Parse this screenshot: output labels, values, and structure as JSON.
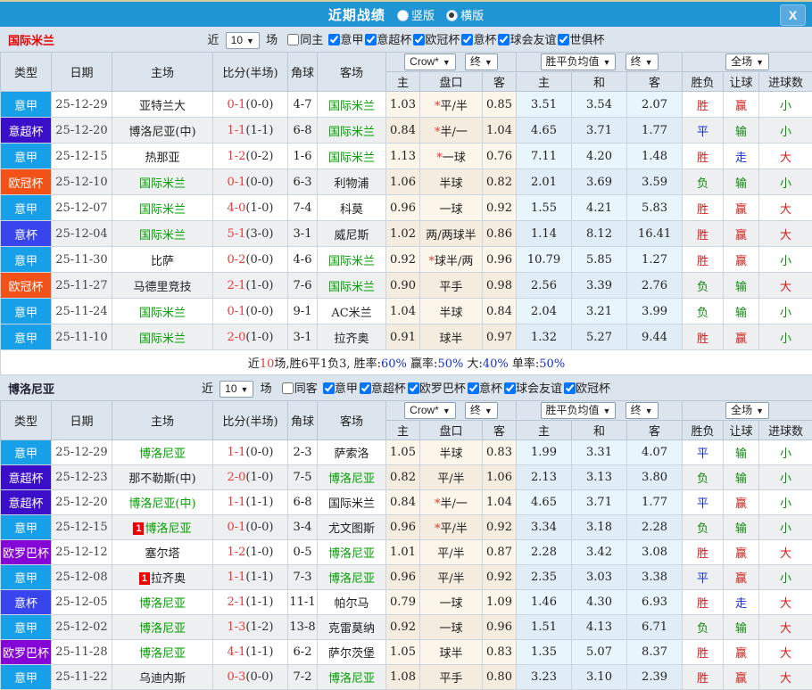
{
  "titlebar": {
    "title": "近期战绩",
    "radio_vertical": "竖版",
    "radio_horizontal": "横版",
    "close": "X"
  },
  "colors": {
    "titlebar_blue": "#1f95d4",
    "focal_team_green": "#00a000",
    "score_red": "#e43b3b",
    "win_red": "#d02020",
    "draw_blue": "#1530d0",
    "lose_green": "#128812"
  },
  "type_colors": {
    "意甲": "#17a0e8",
    "意超杯": "#3b0fc9",
    "欧冠杯": "#f25117",
    "意杯": "#3845ee",
    "欧罗巴杯": "#8406d6"
  },
  "table_headers": {
    "type": "类型",
    "date": "日期",
    "home": "主场",
    "score": "比分(半场)",
    "corner": "角球",
    "away": "客场",
    "crow": "Crow*",
    "final": "终",
    "odds_home": "主",
    "odds_line": "盘口",
    "odds_away": "客",
    "avg_label": "胜平负均值",
    "avg_home": "主",
    "avg_draw": "和",
    "avg_away": "客",
    "fullmatch": "全场",
    "wdl": "胜负",
    "handicap": "让球",
    "goals": "进球数"
  },
  "sections": [
    {
      "team": "国际米兰",
      "team_color": "#e60000",
      "filters": {
        "near": "近",
        "count": "10",
        "games": "场",
        "same": "同主",
        "same_checked": false,
        "leagues": [
          {
            "label": "意甲",
            "checked": true
          },
          {
            "label": "意超杯",
            "checked": true
          },
          {
            "label": "欧冠杯",
            "checked": true
          },
          {
            "label": "意杯",
            "checked": true
          },
          {
            "label": "球会友谊",
            "checked": true
          },
          {
            "label": "世俱杯",
            "checked": true
          }
        ]
      },
      "rows": [
        {
          "type": "意甲",
          "date": "25-12-29",
          "home": "亚特兰大",
          "hh": false,
          "score": "0-1",
          "half": "(0-0)",
          "corner": "4-7",
          "away": "国际米兰",
          "ah": true,
          "o1": "1.03",
          "star": true,
          "line": "平/半",
          "o2": "0.85",
          "a1": "3.51",
          "a2": "3.54",
          "a3": "2.07",
          "r1": "胜",
          "r2": "赢",
          "r3": "小"
        },
        {
          "type": "意超杯",
          "date": "25-12-20",
          "home": "博洛尼亚(中)",
          "hh": false,
          "score": "1-1",
          "half": "(1-1)",
          "corner": "6-8",
          "away": "国际米兰",
          "ah": true,
          "o1": "0.84",
          "star": true,
          "line": "半/一",
          "o2": "1.04",
          "a1": "4.65",
          "a2": "3.71",
          "a3": "1.77",
          "r1": "平",
          "r2": "输",
          "r3": "小"
        },
        {
          "type": "意甲",
          "date": "25-12-15",
          "home": "热那亚",
          "hh": false,
          "score": "1-2",
          "half": "(0-2)",
          "corner": "1-6",
          "away": "国际米兰",
          "ah": true,
          "o1": "1.13",
          "star": true,
          "line": "一球",
          "o2": "0.76",
          "a1": "7.11",
          "a2": "4.20",
          "a3": "1.48",
          "r1": "胜",
          "r2": "走",
          "r3": "大"
        },
        {
          "type": "欧冠杯",
          "date": "25-12-10",
          "home": "国际米兰",
          "hh": true,
          "score": "0-1",
          "half": "(0-0)",
          "corner": "6-3",
          "away": "利物浦",
          "ah": false,
          "o1": "1.06",
          "star": false,
          "line": "半球",
          "o2": "0.82",
          "a1": "2.01",
          "a2": "3.69",
          "a3": "3.59",
          "r1": "负",
          "r2": "输",
          "r3": "小"
        },
        {
          "type": "意甲",
          "date": "25-12-07",
          "home": "国际米兰",
          "hh": true,
          "score": "4-0",
          "half": "(1-0)",
          "corner": "7-4",
          "away": "科莫",
          "ah": false,
          "o1": "0.96",
          "star": false,
          "line": "一球",
          "o2": "0.92",
          "a1": "1.55",
          "a2": "4.21",
          "a3": "5.83",
          "r1": "胜",
          "r2": "赢",
          "r3": "大"
        },
        {
          "type": "意杯",
          "date": "25-12-04",
          "home": "国际米兰",
          "hh": true,
          "score": "5-1",
          "half": "(3-0)",
          "corner": "3-1",
          "away": "威尼斯",
          "ah": false,
          "o1": "1.02",
          "star": false,
          "line": "两/两球半",
          "o2": "0.86",
          "a1": "1.14",
          "a2": "8.12",
          "a3": "16.41",
          "r1": "胜",
          "r2": "赢",
          "r3": "大"
        },
        {
          "type": "意甲",
          "date": "25-11-30",
          "home": "比萨",
          "hh": false,
          "score": "0-2",
          "half": "(0-0)",
          "corner": "4-6",
          "away": "国际米兰",
          "ah": true,
          "o1": "0.92",
          "star": true,
          "line": "球半/两",
          "o2": "0.96",
          "a1": "10.79",
          "a2": "5.85",
          "a3": "1.27",
          "r1": "胜",
          "r2": "赢",
          "r3": "小"
        },
        {
          "type": "欧冠杯",
          "date": "25-11-27",
          "home": "马德里竞技",
          "hh": false,
          "score": "2-1",
          "half": "(1-0)",
          "corner": "7-6",
          "away": "国际米兰",
          "ah": true,
          "o1": "0.90",
          "star": false,
          "line": "平手",
          "o2": "0.98",
          "a1": "2.56",
          "a2": "3.39",
          "a3": "2.76",
          "r1": "负",
          "r2": "输",
          "r3": "大"
        },
        {
          "type": "意甲",
          "date": "25-11-24",
          "home": "国际米兰",
          "hh": true,
          "score": "0-1",
          "half": "(0-0)",
          "corner": "9-1",
          "away": "AC米兰",
          "ah": false,
          "o1": "1.04",
          "star": false,
          "line": "半球",
          "o2": "0.84",
          "a1": "2.04",
          "a2": "3.21",
          "a3": "3.99",
          "r1": "负",
          "r2": "输",
          "r3": "小"
        },
        {
          "type": "意甲",
          "date": "25-11-10",
          "home": "国际米兰",
          "hh": true,
          "score": "2-0",
          "half": "(1-0)",
          "corner": "3-1",
          "away": "拉齐奥",
          "ah": false,
          "o1": "0.91",
          "star": false,
          "line": "球半",
          "o2": "0.97",
          "a1": "1.32",
          "a2": "5.27",
          "a3": "9.44",
          "r1": "胜",
          "r2": "赢",
          "r3": "小"
        }
      ],
      "summary": {
        "pre": "近",
        "count": "10",
        "mid": "场,胜6平1负3, 胜率:",
        "win": "60%",
        "m2": " 赢率:",
        "hw": "50%",
        "m3": " 大:",
        "big": "40%",
        "m4": " 单率:",
        "single": "50%"
      }
    },
    {
      "team": "博洛尼亚",
      "team_color": "#222233",
      "filters": {
        "near": "近",
        "count": "10",
        "games": "场",
        "same": "同客",
        "same_checked": false,
        "leagues": [
          {
            "label": "意甲",
            "checked": true
          },
          {
            "label": "意超杯",
            "checked": true
          },
          {
            "label": "欧罗巴杯",
            "checked": true
          },
          {
            "label": "意杯",
            "checked": true
          },
          {
            "label": "球会友谊",
            "checked": true
          },
          {
            "label": "欧冠杯",
            "checked": true
          }
        ]
      },
      "rows": [
        {
          "type": "意甲",
          "date": "25-12-29",
          "home": "博洛尼亚",
          "hh": true,
          "score": "1-1",
          "half": "(0-0)",
          "corner": "2-3",
          "away": "萨索洛",
          "ah": false,
          "o1": "1.05",
          "star": false,
          "line": "半球",
          "o2": "0.83",
          "a1": "1.99",
          "a2": "3.31",
          "a3": "4.07",
          "r1": "平",
          "r2": "输",
          "r3": "小"
        },
        {
          "type": "意超杯",
          "date": "25-12-23",
          "home": "那不勒斯(中)",
          "hh": false,
          "score": "2-0",
          "half": "(1-0)",
          "corner": "7-5",
          "away": "博洛尼亚",
          "ah": true,
          "o1": "0.82",
          "star": false,
          "line": "平/半",
          "o2": "1.06",
          "a1": "2.13",
          "a2": "3.13",
          "a3": "3.80",
          "r1": "负",
          "r2": "输",
          "r3": "小"
        },
        {
          "type": "意超杯",
          "date": "25-12-20",
          "home": "博洛尼亚(中)",
          "hh": true,
          "score": "1-1",
          "half": "(1-1)",
          "corner": "6-8",
          "away": "国际米兰",
          "ah": false,
          "o1": "0.84",
          "star": true,
          "line": "半/一",
          "o2": "1.04",
          "a1": "4.65",
          "a2": "3.71",
          "a3": "1.77",
          "r1": "平",
          "r2": "赢",
          "r3": "小"
        },
        {
          "type": "意甲",
          "date": "25-12-15",
          "home": "博洛尼亚",
          "hh": true,
          "hcard": "1",
          "score": "0-1",
          "half": "(0-0)",
          "corner": "3-4",
          "away": "尤文图斯",
          "ah": false,
          "o1": "0.96",
          "star": true,
          "line": "平/半",
          "o2": "0.92",
          "a1": "3.34",
          "a2": "3.18",
          "a3": "2.28",
          "r1": "负",
          "r2": "输",
          "r3": "小"
        },
        {
          "type": "欧罗巴杯",
          "date": "25-12-12",
          "home": "塞尔塔",
          "hh": false,
          "score": "1-2",
          "half": "(1-0)",
          "corner": "0-5",
          "away": "博洛尼亚",
          "ah": true,
          "o1": "1.01",
          "star": false,
          "line": "平/半",
          "o2": "0.87",
          "a1": "2.28",
          "a2": "3.42",
          "a3": "3.08",
          "r1": "胜",
          "r2": "赢",
          "r3": "大"
        },
        {
          "type": "意甲",
          "date": "25-12-08",
          "home": "拉齐奥",
          "hh": false,
          "hcard": "1",
          "score": "1-1",
          "half": "(1-1)",
          "corner": "7-3",
          "away": "博洛尼亚",
          "ah": true,
          "o1": "0.96",
          "star": false,
          "line": "平/半",
          "o2": "0.92",
          "a1": "2.35",
          "a2": "3.03",
          "a3": "3.38",
          "r1": "平",
          "r2": "赢",
          "r3": "小"
        },
        {
          "type": "意杯",
          "date": "25-12-05",
          "home": "博洛尼亚",
          "hh": true,
          "score": "2-1",
          "half": "(1-1)",
          "corner": "11-1",
          "away": "帕尔马",
          "ah": false,
          "o1": "0.79",
          "star": false,
          "line": "一球",
          "o2": "1.09",
          "a1": "1.46",
          "a2": "4.30",
          "a3": "6.93",
          "r1": "胜",
          "r2": "走",
          "r3": "大"
        },
        {
          "type": "意甲",
          "date": "25-12-02",
          "home": "博洛尼亚",
          "hh": true,
          "score": "1-3",
          "half": "(1-2)",
          "corner": "13-8",
          "away": "克雷莫纳",
          "ah": false,
          "o1": "0.92",
          "star": false,
          "line": "一球",
          "o2": "0.96",
          "a1": "1.51",
          "a2": "4.13",
          "a3": "6.71",
          "r1": "负",
          "r2": "输",
          "r3": "大"
        },
        {
          "type": "欧罗巴杯",
          "date": "25-11-28",
          "home": "博洛尼亚",
          "hh": true,
          "score": "4-1",
          "half": "(1-1)",
          "corner": "6-2",
          "away": "萨尔茨堡",
          "ah": false,
          "o1": "1.05",
          "star": false,
          "line": "球半",
          "o2": "0.83",
          "a1": "1.35",
          "a2": "5.07",
          "a3": "8.37",
          "r1": "胜",
          "r2": "赢",
          "r3": "大"
        },
        {
          "type": "意甲",
          "date": "25-11-22",
          "home": "乌迪内斯",
          "hh": false,
          "score": "0-3",
          "half": "(0-0)",
          "corner": "7-2",
          "away": "博洛尼亚",
          "ah": true,
          "o1": "1.08",
          "star": false,
          "line": "平手",
          "o2": "0.80",
          "a1": "3.23",
          "a2": "3.10",
          "a3": "2.39",
          "r1": "胜",
          "r2": "赢",
          "r3": "大"
        }
      ]
    }
  ]
}
